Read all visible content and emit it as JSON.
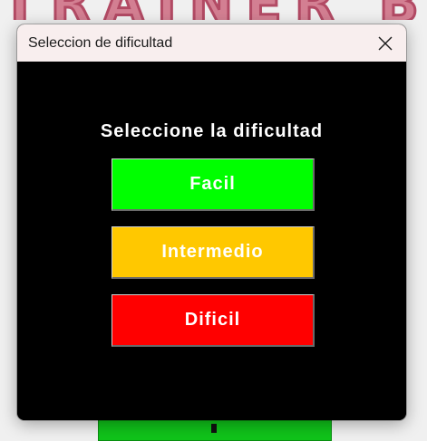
{
  "background": {
    "title_text": "TRAINER BRAIN"
  },
  "dialog": {
    "title": "Seleccion de dificultad",
    "close_icon": "close-icon",
    "heading": "Seleccione la dificultad",
    "options": [
      {
        "label": "Facil",
        "color": "#00ff00"
      },
      {
        "label": "Intermedio",
        "color": "#ffc800"
      },
      {
        "label": "Dificil",
        "color": "#ff0000"
      }
    ]
  }
}
